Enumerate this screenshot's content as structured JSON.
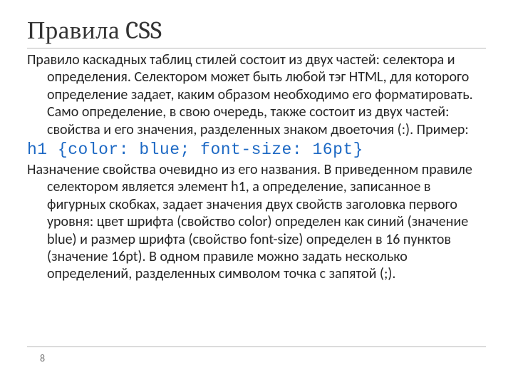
{
  "title": "Правила CSS",
  "paragraph1": "Правило каскадных таблиц стилей состоит из двух частей: селектора и определения. Селектором может быть любой тэг HTML, для которого определение задает, каким образом необходимо его форматировать. Само определение, в свою очередь, также состоит из двух частей: свойства и его значения, разделенных знаком двоеточия (:). Пример:",
  "code": "h1 {color: blue; font-size: 16pt}",
  "paragraph2": "Назначение свойства очевидно из его названия. В приведенном правиле селектором является элемент h1, а определение, записанное в фигурных скобках, задает значения двух свойств заголовка первого уровня: цвет шрифта (свойство color) определен как синий (значение blue) и размер шрифта (свойство font-size) определен в 16 пунктов (значение 16pt). В одном правиле можно задать несколько определений, разделенных символом точка с запятой (;).",
  "pageNumber": "8"
}
